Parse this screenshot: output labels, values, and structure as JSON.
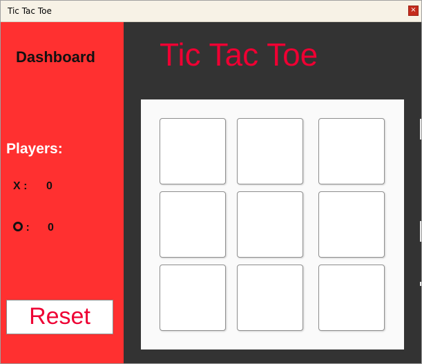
{
  "window": {
    "title": "Tic Tac Toe",
    "close_label": "×"
  },
  "sidebar": {
    "title": "Dashboard",
    "players_heading": "Players:",
    "player_x": {
      "label": "X :",
      "score": "0"
    },
    "player_o": {
      "label": ":",
      "icon": "circle-o-icon",
      "score": "0"
    },
    "reset_label": "Reset"
  },
  "main": {
    "title": "Tic Tac Toe",
    "board": {
      "cells": [
        "",
        "",
        "",
        "",
        "",
        "",
        "",
        "",
        ""
      ]
    }
  },
  "colors": {
    "sidebar_bg": "#ff3030",
    "main_bg": "#333333",
    "accent_red": "#ee0033",
    "board_bg": "#fafafa"
  }
}
